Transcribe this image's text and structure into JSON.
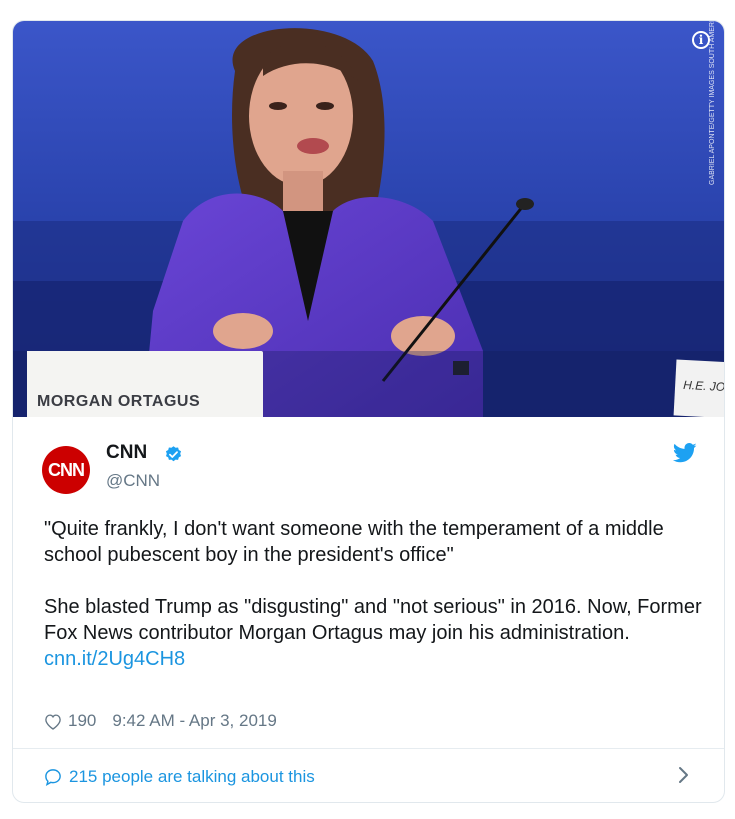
{
  "photo": {
    "placard_name": "MORGAN ORTAGUS",
    "placard_right": "H.E. JOR",
    "credit": "GABRIEL APONTE/GETTY IMAGES SOUTH AMERICA",
    "info_symbol": "i"
  },
  "tweet": {
    "avatar_text": "CNN",
    "name": "CNN",
    "handle": "@CNN",
    "quote": "\"Quite frankly, I don't want someone with the temperament of a middle school pubescent boy in the president's office\"",
    "body": "She blasted Trump as \"disgusting\" and \"not serious\" in 2016. Now, Former Fox News contributor Morgan Ortagus may join his administration.",
    "link": "cnn.it/2Ug4CH8",
    "likes": "190",
    "timestamp": "9:42 AM - Apr 3, 2019",
    "talking": "215 people are talking about this"
  },
  "colors": {
    "link": "#1b95e0",
    "cnn_red": "#cc0000",
    "twitter_blue": "#1da1f2",
    "meta": "#657786"
  },
  "icons": [
    "info-icon",
    "verified-icon",
    "twitter-bird-icon",
    "heart-icon",
    "comment-bubble-icon",
    "chevron-right-icon"
  ]
}
